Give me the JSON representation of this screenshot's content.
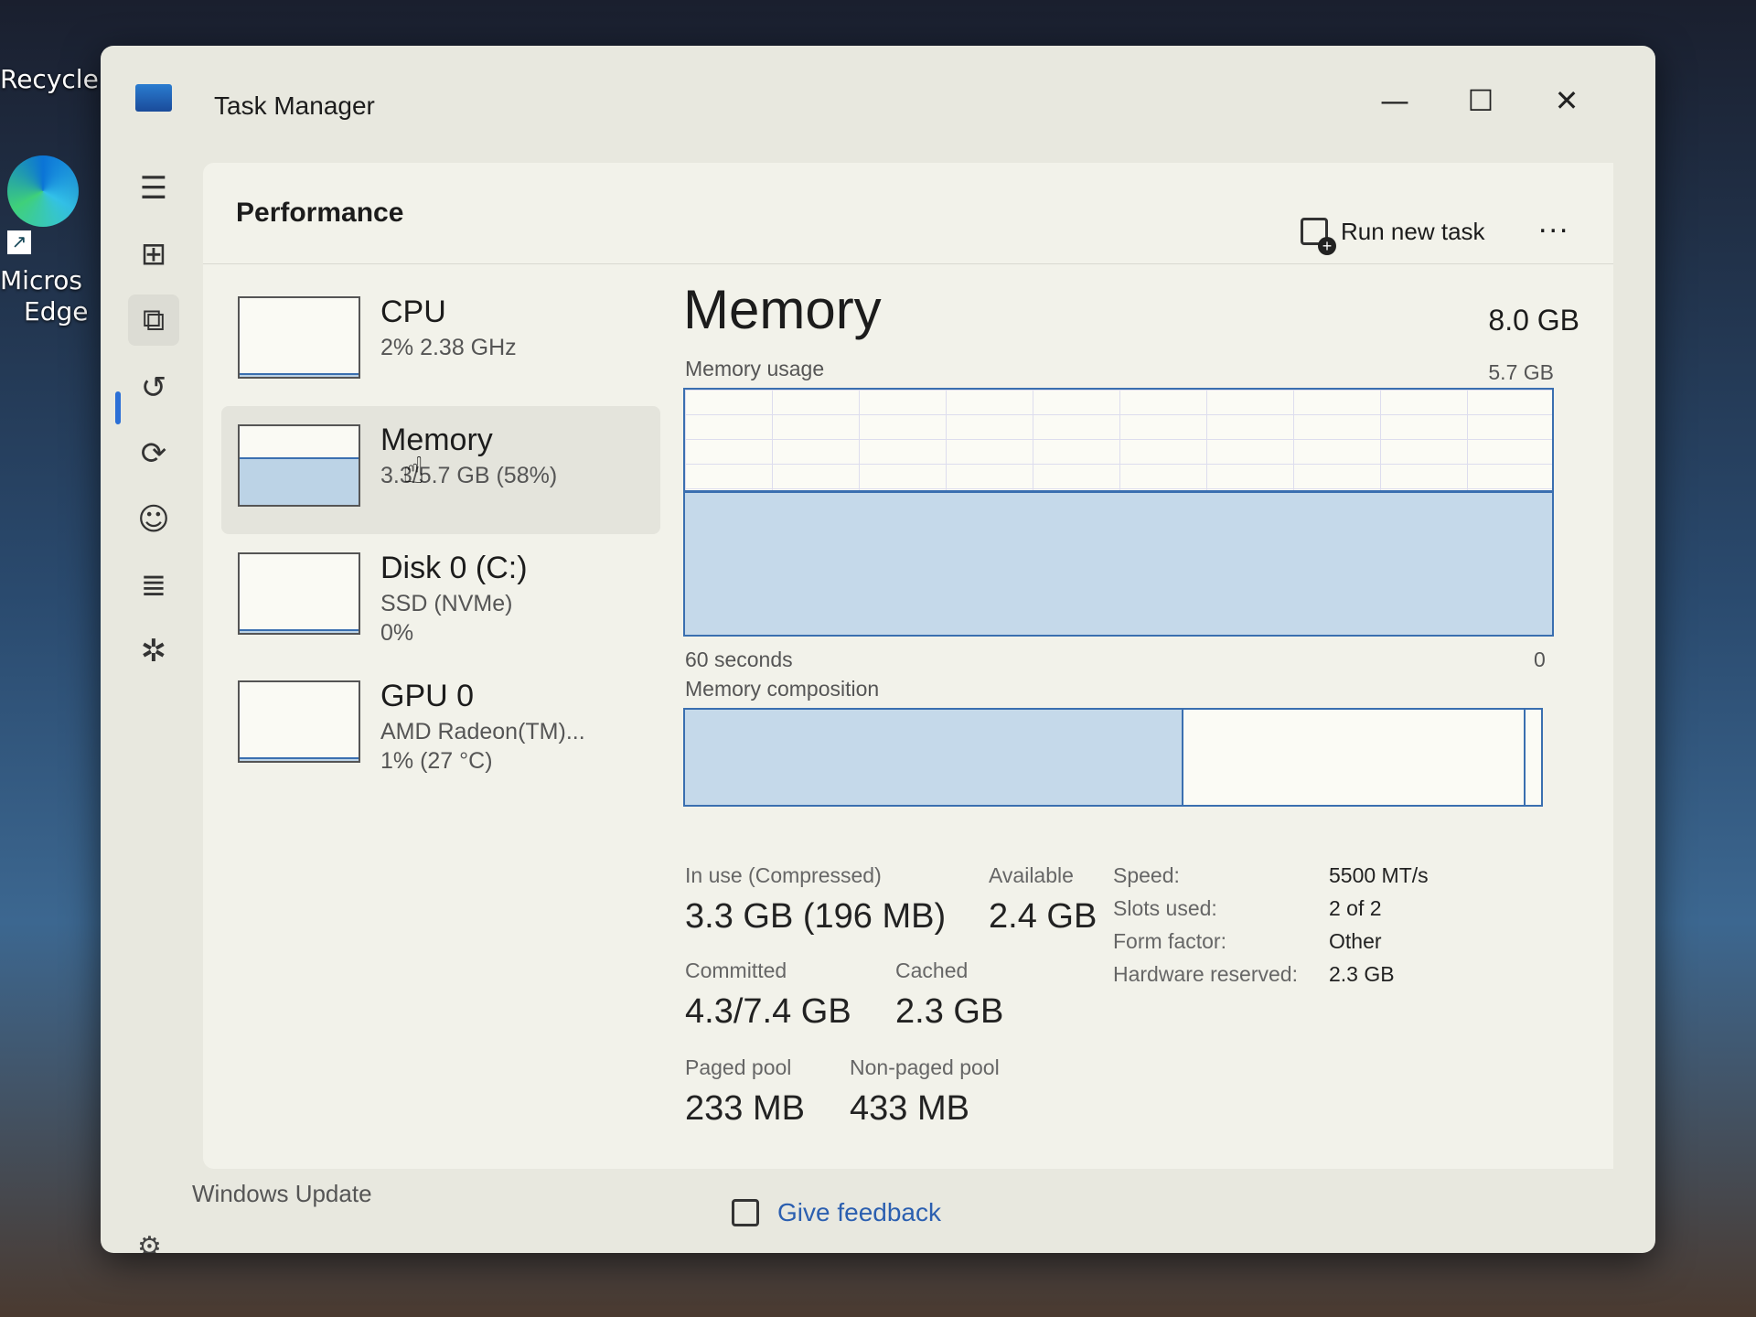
{
  "desktop": {
    "recycle_label": "Recycle",
    "edge_label_1": "Micros",
    "edge_label_2": "Edge"
  },
  "window": {
    "title": "Task Manager",
    "minimize": "—",
    "maximize": "☐",
    "close": "✕"
  },
  "nav": {
    "items": [
      {
        "name": "hamburger-menu-icon",
        "glyph": "☰"
      },
      {
        "name": "processes-icon",
        "glyph": "⊞"
      },
      {
        "name": "performance-icon",
        "glyph": "⧉"
      },
      {
        "name": "app-history-icon",
        "glyph": "↺"
      },
      {
        "name": "startup-apps-icon",
        "glyph": "⟳"
      },
      {
        "name": "users-icon",
        "glyph": "☺"
      },
      {
        "name": "details-icon",
        "glyph": "≣"
      },
      {
        "name": "services-icon",
        "glyph": "✲"
      }
    ],
    "settings_glyph": "⚙"
  },
  "header": {
    "page_title": "Performance",
    "run_new_task": "Run new task",
    "more": "..."
  },
  "resources": [
    {
      "name": "CPU",
      "sub": "2% 2.38 GHz",
      "sub2": "",
      "fill": 0.02
    },
    {
      "name": "Memory",
      "sub": "3.3/5.7 GB (58%)",
      "sub2": "",
      "fill": 0.58
    },
    {
      "name": "Disk 0 (C:)",
      "sub": "SSD (NVMe)",
      "sub2": "0%",
      "fill": 0.0
    },
    {
      "name": "GPU 0",
      "sub": "AMD Radeon(TM)...",
      "sub2": "1% (27 °C)",
      "fill": 0.01
    }
  ],
  "memory": {
    "title": "Memory",
    "total": "8.0 GB",
    "usage_label": "Memory usage",
    "usage_max": "5.7 GB",
    "usage_fraction": 0.58,
    "time_left": "60 seconds",
    "time_right": "0",
    "composition_label": "Memory composition",
    "composition_in_use_fraction": 0.58,
    "composition_modified_fraction": 0.02,
    "stats": {
      "in_use_label": "In use (Compressed)",
      "in_use_value": "3.3 GB (196 MB)",
      "available_label": "Available",
      "available_value": "2.4 GB",
      "committed_label": "Committed",
      "committed_value": "4.3/7.4 GB",
      "cached_label": "Cached",
      "cached_value": "2.3 GB",
      "paged_label": "Paged pool",
      "paged_value": "233 MB",
      "nonpaged_label": "Non-paged pool",
      "nonpaged_value": "433 MB"
    },
    "details": [
      {
        "k": "Speed:",
        "v": "5500 MT/s"
      },
      {
        "k": "Slots used:",
        "v": "2 of 2"
      },
      {
        "k": "Form factor:",
        "v": "Other"
      },
      {
        "k": "Hardware reserved:",
        "v": "2.3 GB"
      }
    ]
  },
  "footer": {
    "windows_update": "Windows Update",
    "give_feedback": "Give feedback"
  }
}
